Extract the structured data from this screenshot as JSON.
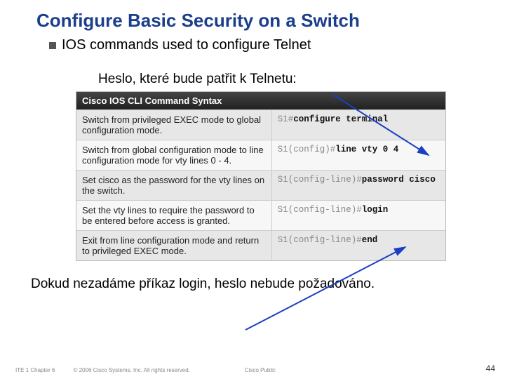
{
  "title": "Configure Basic Security on a Switch",
  "bullet": "IOS commands used to configure Telnet",
  "subhead": "Heslo, které bude patřit k Telnetu:",
  "syntax": {
    "header": "Cisco IOS CLI Command Syntax",
    "rows": [
      {
        "desc": "Switch from privileged EXEC mode to global configuration mode.",
        "prompt": "S1#",
        "cmd": "configure terminal"
      },
      {
        "desc": "Switch from global configuration mode to line configuration mode for vty lines 0 - 4.",
        "prompt": "S1(config)#",
        "cmd": "line vty 0 4"
      },
      {
        "desc": "Set cisco as the password for the vty lines on the switch.",
        "prompt": "S1(config-line)#",
        "cmd": "password cisco"
      },
      {
        "desc": "Set the vty lines to require the password to be entered before access is granted.",
        "prompt": "S1(config-line)#",
        "cmd": "login"
      },
      {
        "desc": "Exit from line configuration mode and return to privileged EXEC mode.",
        "prompt": "S1(config-line)#",
        "cmd": "end"
      }
    ]
  },
  "bottom_note": "Dokud nezadáme příkaz login, heslo nebude požadováno.",
  "footer": {
    "left": "ITE 1 Chapter 6",
    "copyright": "© 2006 Cisco Systems, Inc. All rights reserved.",
    "classification": "Cisco Public",
    "page": "44"
  }
}
